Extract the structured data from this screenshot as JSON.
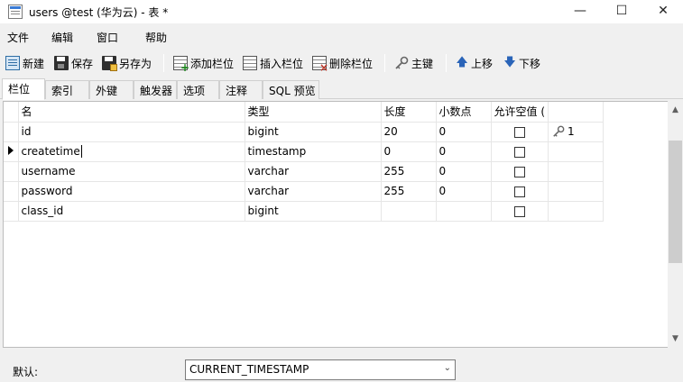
{
  "window": {
    "title": "users @test (华为云) - 表 *",
    "minimize": "—",
    "maximize": "☐",
    "close": "✕"
  },
  "menu": [
    "文件",
    "编辑",
    "窗口",
    "帮助"
  ],
  "toolbar": {
    "new": "新建",
    "save": "保存",
    "save_as": "另存为",
    "add_column": "添加栏位",
    "insert_column": "插入栏位",
    "delete_column": "删除栏位",
    "primary_key": "主键",
    "move_up": "上移",
    "move_down": "下移"
  },
  "tabs": [
    "栏位",
    "索引",
    "外键",
    "触发器",
    "选项",
    "注释",
    "SQL 预览"
  ],
  "grid": {
    "headers": [
      "名",
      "类型",
      "长度",
      "小数点",
      "允许空值 ("
    ],
    "rows": [
      {
        "name": "id",
        "type": "bigint",
        "length": "20",
        "decimals": "0",
        "nullable": false,
        "key": "1"
      },
      {
        "name": "createtime",
        "type": "timestamp",
        "length": "0",
        "decimals": "0",
        "nullable": false,
        "key": ""
      },
      {
        "name": "username",
        "type": "varchar",
        "length": "255",
        "decimals": "0",
        "nullable": false,
        "key": ""
      },
      {
        "name": "password",
        "type": "varchar",
        "length": "255",
        "decimals": "0",
        "nullable": false,
        "key": ""
      },
      {
        "name": "class_id",
        "type": "bigint",
        "length": "",
        "decimals": "",
        "nullable": false,
        "key": ""
      }
    ],
    "selected_row": 1
  },
  "bottom": {
    "default_label": "默认:",
    "default_value": "CURRENT_TIMESTAMP"
  }
}
